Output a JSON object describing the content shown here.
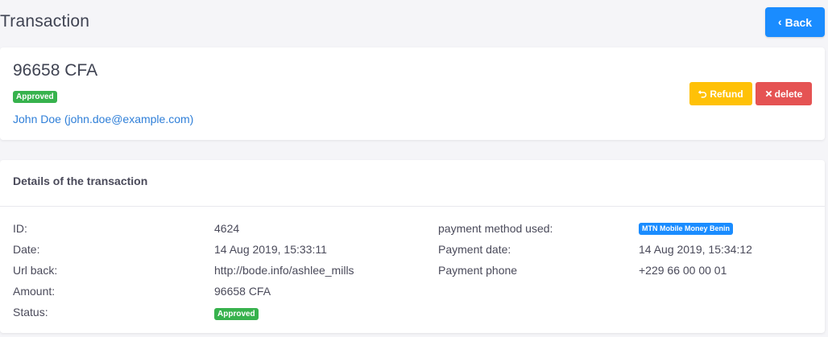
{
  "header": {
    "title": "Transaction",
    "back_label": "Back"
  },
  "summary": {
    "amount": "96658 CFA",
    "status_badge": "Approved",
    "customer": "John Doe (john.doe@example.com)",
    "refund_label": "Refund",
    "delete_label": "delete"
  },
  "details": {
    "heading": "Details of the transaction",
    "left": [
      {
        "label": "ID:",
        "value": "4624"
      },
      {
        "label": "Date:",
        "value": "14 Aug 2019, 15:33:11"
      },
      {
        "label": "Url back:",
        "value": "http://bode.info/ashlee_mills"
      },
      {
        "label": "Amount:",
        "value": "96658 CFA"
      },
      {
        "label": "Status:",
        "value": "Approved"
      }
    ],
    "right": [
      {
        "label": "payment method used:",
        "value": "MTN Mobile Money Benin"
      },
      {
        "label": "Payment date:",
        "value": "14 Aug 2019, 15:34:12"
      },
      {
        "label": "Payment phone",
        "value": "+229 66 00 00 01"
      }
    ]
  },
  "colors": {
    "primary": "#1a8cff",
    "success": "#37b24d",
    "warning": "#ffc107",
    "danger": "#e55353",
    "link": "#2f7fd8"
  },
  "icons": {
    "back": "chevron-left-icon",
    "refund": "undo-icon",
    "delete": "close-icon"
  }
}
